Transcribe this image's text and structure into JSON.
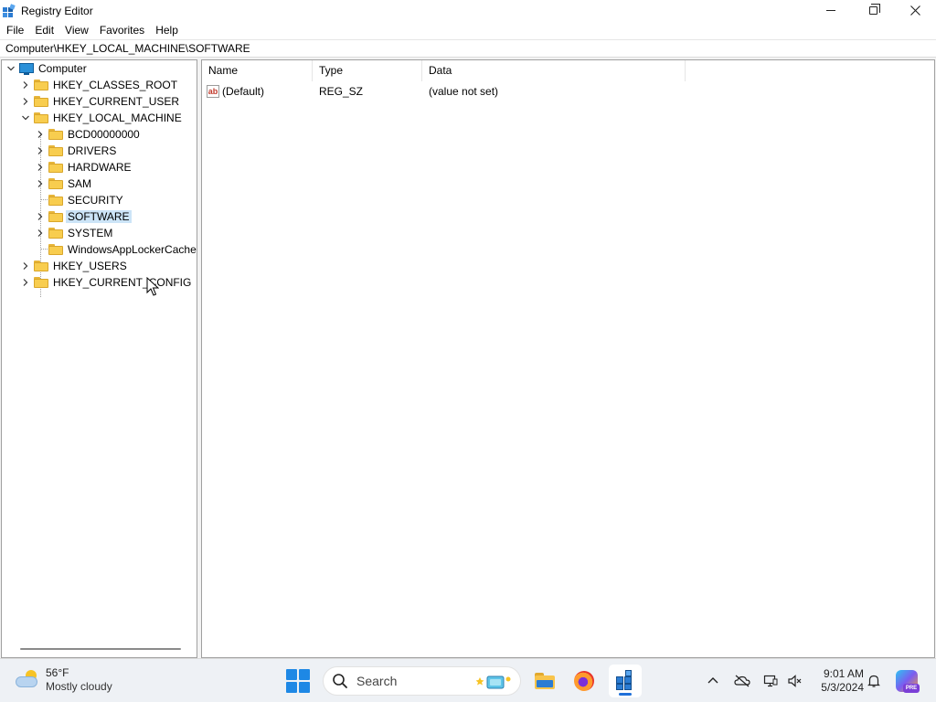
{
  "window": {
    "title": "Registry Editor",
    "controls": {
      "minimize": "minimize",
      "restore": "restore",
      "close": "close"
    }
  },
  "menu": [
    "File",
    "Edit",
    "View",
    "Favorites",
    "Help"
  ],
  "address": "Computer\\HKEY_LOCAL_MACHINE\\SOFTWARE",
  "tree": {
    "root": "Computer",
    "hives": [
      {
        "label": "HKEY_CLASSES_ROOT",
        "expanded": false
      },
      {
        "label": "HKEY_CURRENT_USER",
        "expanded": false
      },
      {
        "label": "HKEY_LOCAL_MACHINE",
        "expanded": true,
        "children": [
          {
            "label": "BCD00000000",
            "has_children": true
          },
          {
            "label": "DRIVERS",
            "has_children": true
          },
          {
            "label": "HARDWARE",
            "has_children": true
          },
          {
            "label": "SAM",
            "has_children": true
          },
          {
            "label": "SECURITY",
            "has_children": false
          },
          {
            "label": "SOFTWARE",
            "has_children": true,
            "selected": true
          },
          {
            "label": "SYSTEM",
            "has_children": true
          },
          {
            "label": "WindowsAppLockerCache",
            "has_children": false
          }
        ]
      },
      {
        "label": "HKEY_USERS",
        "expanded": false
      },
      {
        "label": "HKEY_CURRENT_CONFIG",
        "expanded": false
      }
    ]
  },
  "list": {
    "columns": [
      "Name",
      "Type",
      "Data"
    ],
    "rows": [
      {
        "icon": "string-value-icon",
        "icon_text": "ab",
        "name": "(Default)",
        "type": "REG_SZ",
        "data": "(value not set)"
      }
    ]
  },
  "taskbar": {
    "weather": {
      "temp": "56°F",
      "condition": "Mostly cloudy",
      "icon": "partly-cloudy-icon"
    },
    "search_placeholder": "Search",
    "apps": [
      {
        "name": "file-explorer-icon",
        "active": false
      },
      {
        "name": "firefox-icon",
        "active": false
      },
      {
        "name": "registry-editor-icon",
        "active": true
      }
    ],
    "tray_icons": [
      "chevron-up-icon",
      "onedrive-offline-icon",
      "network-icon",
      "volume-muted-icon"
    ],
    "clock": {
      "time": "9:01 AM",
      "date": "5/3/2024"
    },
    "copilot_badge": "PRE"
  },
  "colors": {
    "selection": "#cce4f7",
    "accent": "#1e88e5",
    "folder": "#f8cd4f"
  }
}
